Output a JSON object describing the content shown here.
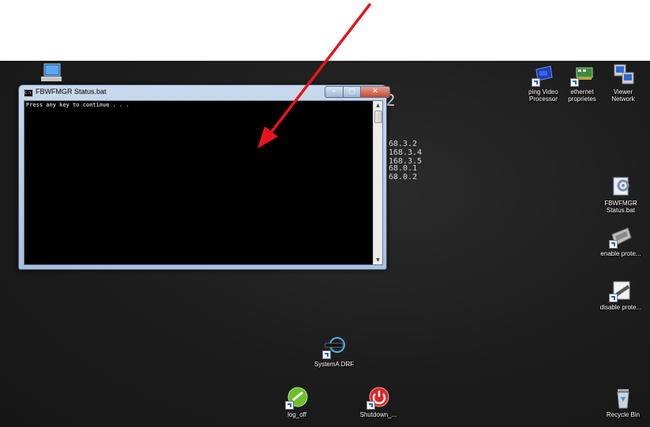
{
  "window": {
    "title": "FBWFMGR Status.bat",
    "icon_glyph": "C:\\",
    "output_text": "Press any key to continue . . .",
    "controls": {
      "minimize": "–",
      "maximize": "□",
      "close": "✕"
    }
  },
  "wallpaper": {
    "partial_number": "2",
    "ip_lines_1": "68.3.2\n168.3.4\n168.3.5",
    "ip_lines_2": "68.0.1\n68.0.2"
  },
  "desktop_icons": [
    {
      "label": "ping Video Processor",
      "icon": "video-processor-icon"
    },
    {
      "label": "ethernet proprietes",
      "icon": "network-card-icon"
    },
    {
      "label": "Viewer Network",
      "icon": "network-computers-icon"
    },
    {
      "label": "FBWFMGR Status.bat",
      "icon": "batch-file-icon"
    },
    {
      "label": "enable prote...",
      "icon": "drive-enable-icon"
    },
    {
      "label": "disable prote...",
      "icon": "drive-disable-icon"
    },
    {
      "label": "SystemA DRF",
      "icon": "drf-icon"
    },
    {
      "label": "log_off",
      "icon": "logoff-icon"
    },
    {
      "label": "Shutdown_...",
      "icon": "shutdown-icon"
    },
    {
      "label": "Recycle Bin",
      "icon": "recycle-bin-icon"
    }
  ],
  "annotation": {
    "color": "#e8141b"
  }
}
